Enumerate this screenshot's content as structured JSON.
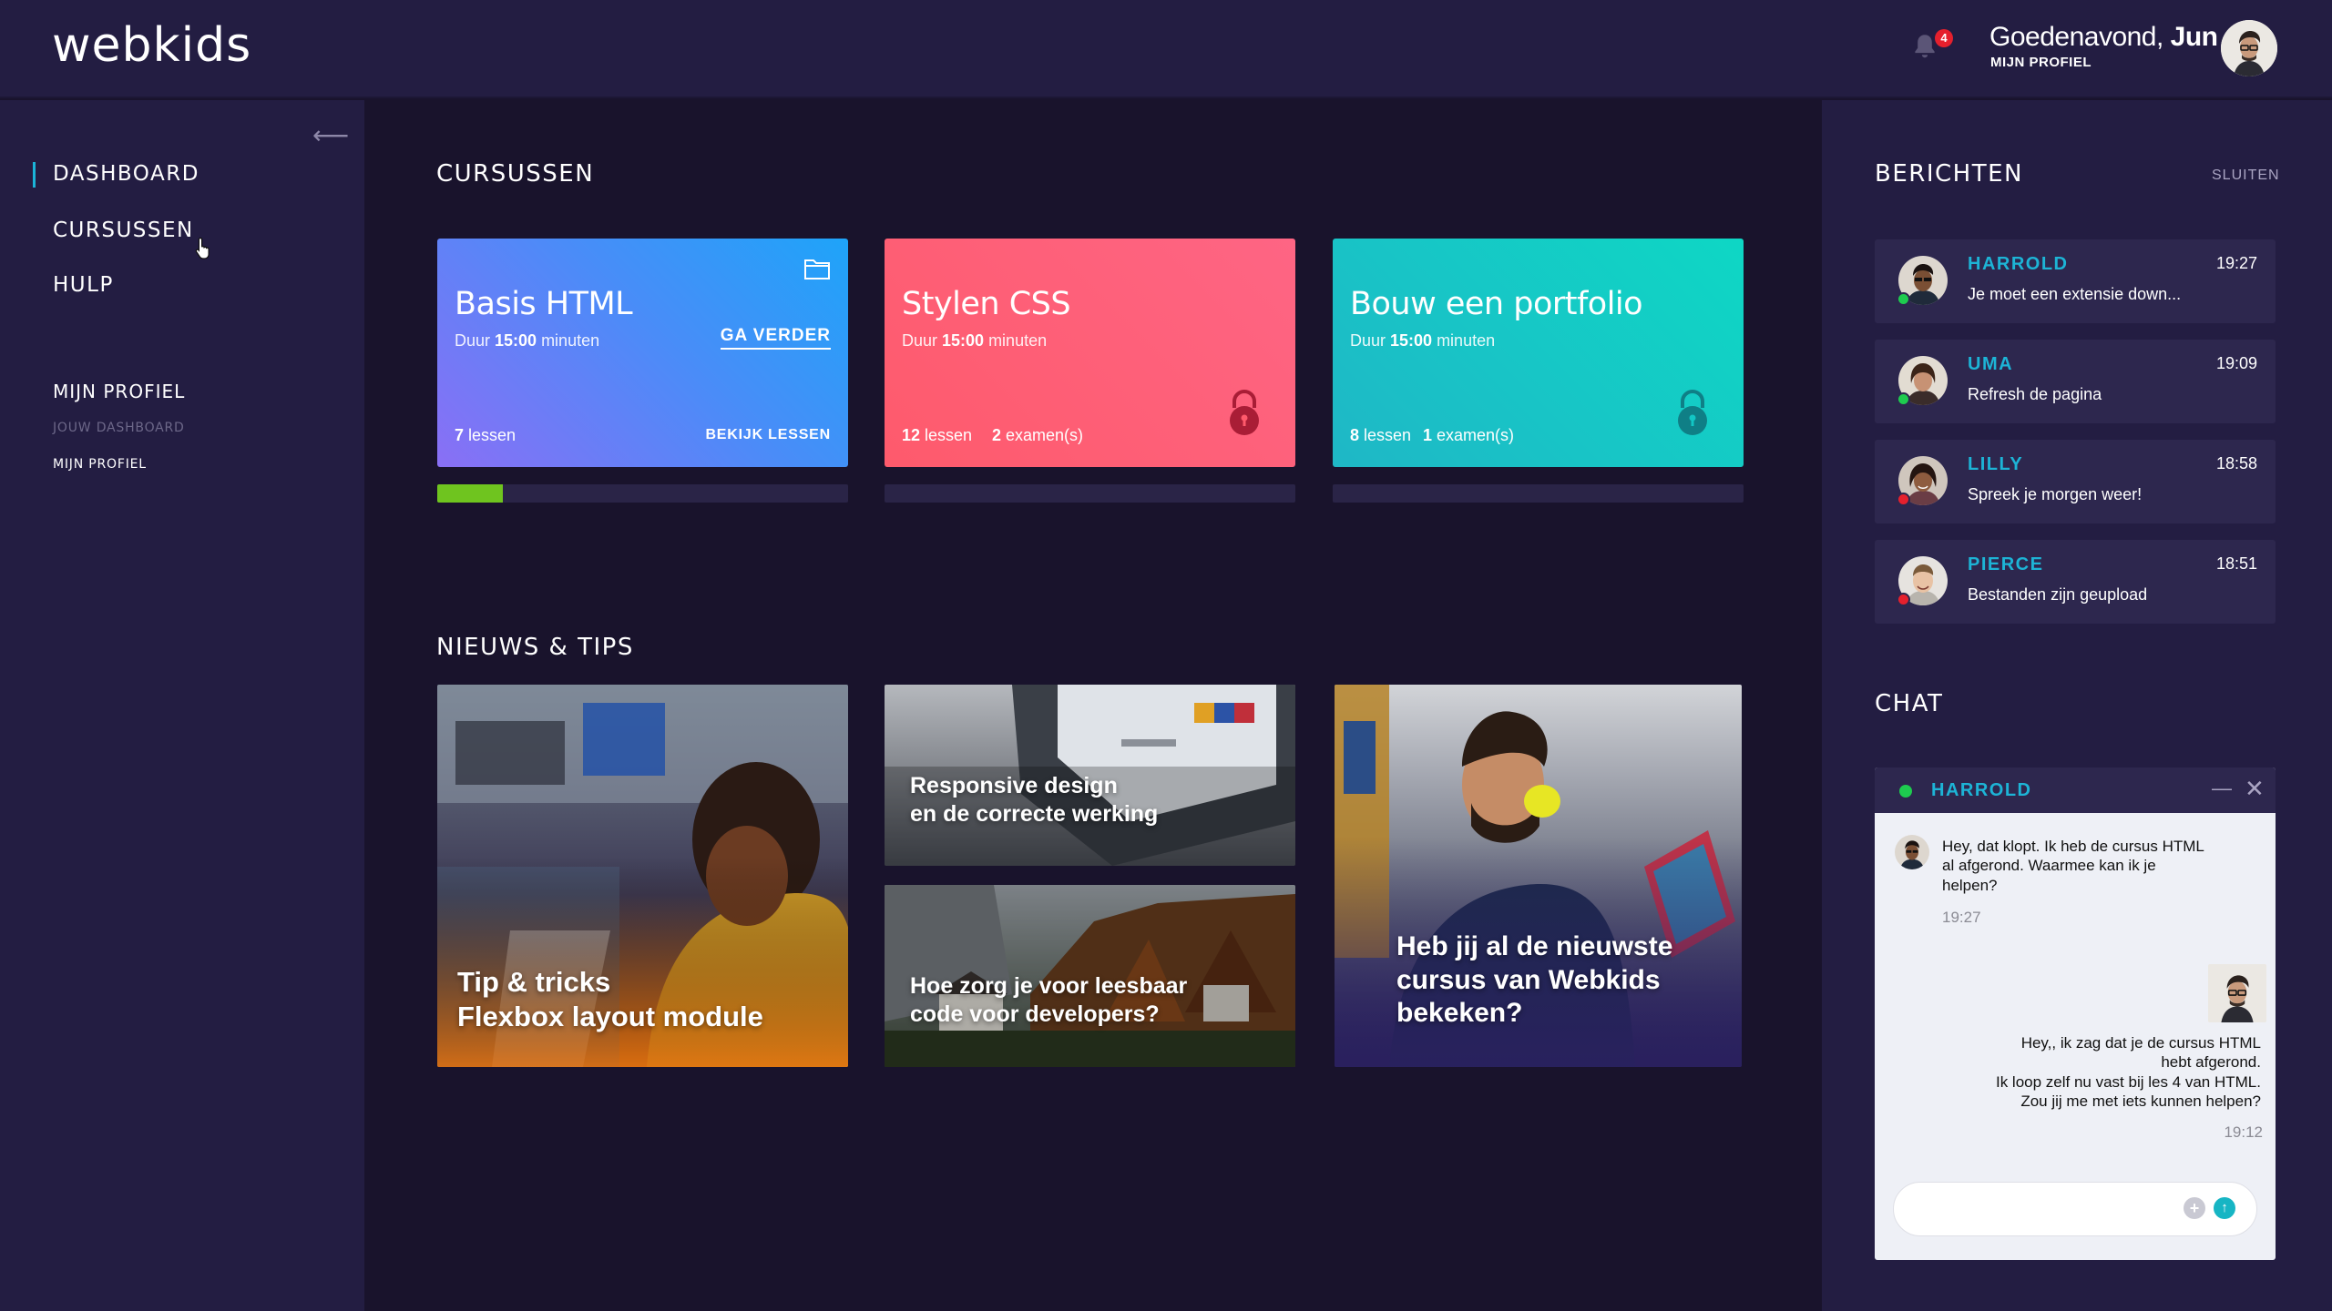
{
  "brand": {
    "logo": "webkids"
  },
  "header": {
    "notification_count": "4",
    "greeting_prefix": "Goedenavond, ",
    "greeting_name": "Jun",
    "profile_link": "MIJN PROFIEL"
  },
  "sidebar": {
    "collapse_icon": "arrow-left-icon",
    "items": [
      {
        "label": "DASHBOARD",
        "active": true
      },
      {
        "label": "CURSUSSEN",
        "active": false
      },
      {
        "label": "HULP",
        "active": false
      }
    ],
    "profile_section": {
      "title": "MIJN PROFIEL",
      "items": [
        {
          "label": "JOUW DASHBOARD",
          "muted": true
        },
        {
          "label": "MIJN PROFIEL",
          "muted": false
        }
      ]
    }
  },
  "courses": {
    "section_title": "CURSUSSEN",
    "cards": [
      {
        "title": "Basis HTML",
        "duration_prefix": "Duur ",
        "duration_value": "15:00",
        "duration_suffix": " minuten",
        "lessons_count": "7",
        "lessons_label": " lessen",
        "action_primary": "GA VERDER",
        "action_secondary": "BEKIJK LESSEN",
        "icon": "folder-icon",
        "progress": 0.16
      },
      {
        "title": "Stylen CSS",
        "duration_prefix": "Duur ",
        "duration_value": "15:00",
        "duration_suffix": " minuten",
        "lessons_count": "12",
        "lessons_label": " lessen",
        "exams_count": "2",
        "exams_label": " examen(s)",
        "icon": "lock-icon",
        "progress": 0
      },
      {
        "title": "Bouw een portfolio",
        "duration_prefix": "Duur ",
        "duration_value": "15:00",
        "duration_suffix": " minuten",
        "lessons_count": "8",
        "lessons_label": " lessen",
        "exams_count": "1",
        "exams_label": " examen(s)",
        "icon": "lock-icon",
        "progress": 0
      }
    ]
  },
  "news": {
    "section_title": "NIEUWS & TIPS",
    "items": [
      {
        "title": "Tip & tricks\nFlexbox layout module"
      },
      {
        "title": "Responsive design\nen de correcte werking"
      },
      {
        "title": "Hoe zorg je voor leesbaar\ncode voor developers?"
      },
      {
        "title": "Heb jij al de nieuwste\ncursus van Webkids\nbekeken?"
      }
    ]
  },
  "messages": {
    "section_title": "BERICHTEN",
    "close_label": "SLUITEN",
    "items": [
      {
        "name": "HARROLD",
        "time": "19:27",
        "text": "Je moet een extensie down...",
        "status_color": "#1ecb4f"
      },
      {
        "name": "UMA",
        "time": "19:09",
        "text": "Refresh de pagina",
        "status_color": "#1ecb4f"
      },
      {
        "name": "LILLY",
        "time": "18:58",
        "text": "Spreek je morgen weer!",
        "status_color": "#e5202d"
      },
      {
        "name": "PIERCE",
        "time": "18:51",
        "text": "Bestanden zijn geupload",
        "status_color": "#e5202d"
      }
    ]
  },
  "chat": {
    "section_title": "CHAT",
    "contact": "HARROLD",
    "minimize_icon": "minimize-icon",
    "close_icon": "close-icon",
    "messages": [
      {
        "from": "contact",
        "text": "Hey, dat klopt. Ik heb de cursus HTML\nal afgerond. Waarmee kan ik je\nhelpen?",
        "time": "19:27"
      },
      {
        "from": "me",
        "text": "Hey,, ik zag dat je de cursus HTML\nhebt afgerond.\nIk loop zelf nu vast bij les 4 van HTML.\nZou jij me met iets kunnen helpen?",
        "time": "19:12"
      }
    ],
    "input_value": "",
    "attach_icon": "plus-icon",
    "send_icon": "send-icon"
  },
  "colors": {
    "background": "#19132c",
    "panel": "#231d42",
    "accent": "#1db4d6",
    "progress": "#6fc41f",
    "online": "#1ecb4f",
    "offline": "#e5202d"
  }
}
